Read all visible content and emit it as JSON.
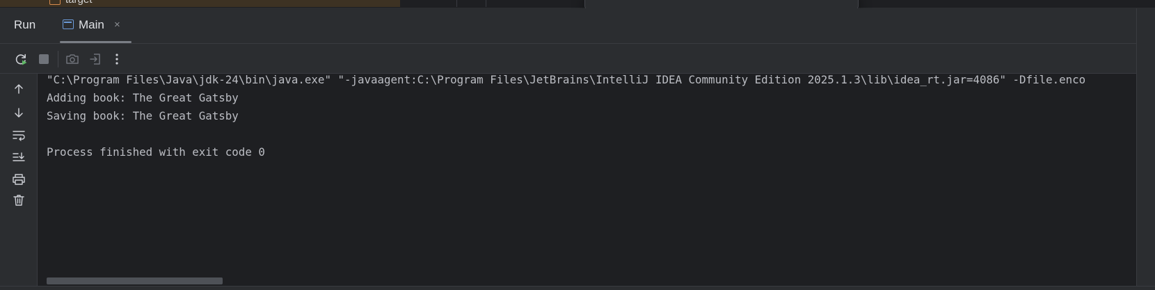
{
  "top_strip": {
    "folder_label": "target"
  },
  "tool_window": {
    "title": "Run",
    "tab": {
      "label": "Main",
      "close_glyph": "×",
      "icon": "run-config-window-icon"
    }
  },
  "toolbar": {
    "buttons": [
      {
        "name": "rerun-icon",
        "enabled": true
      },
      {
        "name": "stop-icon",
        "enabled": false
      },
      {
        "name": "camera-icon",
        "enabled": false
      },
      {
        "name": "exit-icon",
        "enabled": false
      },
      {
        "name": "more-vertical-icon",
        "enabled": true
      }
    ]
  },
  "gutter": {
    "buttons": [
      "arrow-up-icon",
      "arrow-down-icon",
      "soft-wrap-icon",
      "scroll-to-end-icon",
      "print-icon",
      "trash-icon"
    ]
  },
  "console": {
    "lines": [
      "\"C:\\Program Files\\Java\\jdk-24\\bin\\java.exe\" \"-javaagent:C:\\Program Files\\JetBrains\\IntelliJ IDEA Community Edition 2025.1.3\\lib\\idea_rt.jar=4086\" -Dfile.enco",
      "Adding book: The Great Gatsby",
      "Saving book: The Great Gatsby",
      "",
      "Process finished with exit code 0"
    ]
  },
  "colors": {
    "background": "#1e1f22",
    "panel": "#2b2d30",
    "text": "#bcbec4",
    "rerun_green": "#5fb865",
    "icon_gray": "#ced0d6",
    "disabled_gray": "#6f737a"
  }
}
